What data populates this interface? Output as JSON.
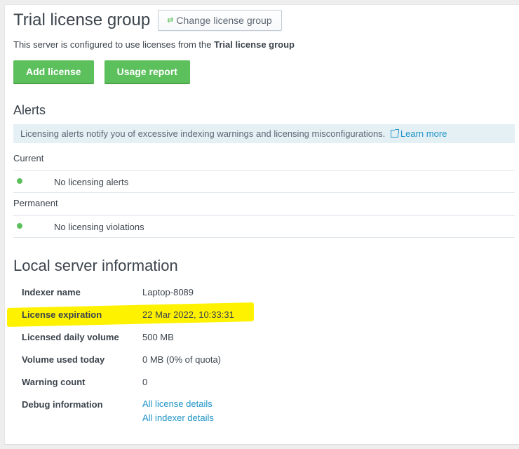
{
  "header": {
    "title": "Trial license group",
    "change_group_label": "Change license group",
    "subtitle_prefix": "This server is configured to use licenses from the ",
    "subtitle_group": "Trial license group"
  },
  "actions": {
    "add_license_label": "Add license",
    "usage_report_label": "Usage report"
  },
  "alerts": {
    "title": "Alerts",
    "info_text": "Licensing alerts notify you of excessive indexing warnings and licensing misconfigurations.",
    "learn_more_label": "Learn more",
    "current_label": "Current",
    "current_message": "No licensing alerts",
    "permanent_label": "Permanent",
    "permanent_message": "No licensing violations",
    "status_color": "#5cc05c"
  },
  "local_server": {
    "title": "Local server information",
    "rows": [
      {
        "label": "Indexer name",
        "value": "Laptop-8089"
      },
      {
        "label": "License expiration",
        "value": "22 Mar 2022, 10:33:31"
      },
      {
        "label": "Licensed daily volume",
        "value": "500 MB"
      },
      {
        "label": "Volume used today",
        "value": "0 MB (0% of quota)"
      },
      {
        "label": "Warning count",
        "value": "0"
      },
      {
        "label": "Debug information",
        "links": [
          "All license details",
          "All indexer details"
        ]
      }
    ]
  },
  "colors": {
    "accent_green": "#5cc05c",
    "link_blue": "#1e93c6",
    "highlight_yellow": "#fff200",
    "info_bar_bg": "#e5f0f5"
  },
  "icons": {
    "change_group": "arrows-exchange-icon",
    "learn_more": "external-link-icon",
    "status": "status-dot-icon"
  }
}
